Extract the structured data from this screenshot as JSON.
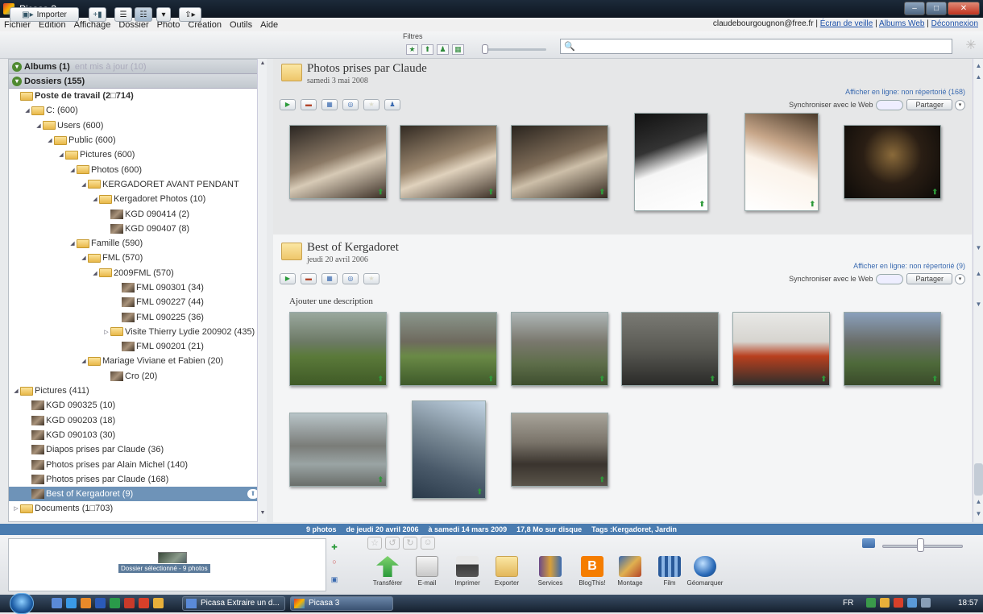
{
  "window": {
    "title": "Picasa 3"
  },
  "menu": [
    "Fichier",
    "Edition",
    "Affichage",
    "Dossier",
    "Photo",
    "Création",
    "Outils",
    "Aide"
  ],
  "account": {
    "email": "claudebourgougnon@free.fr",
    "sep": "|",
    "screensaver": "Écran de veille",
    "web_albums": "Albums Web",
    "logout": "Déconnexion"
  },
  "toolbar": {
    "import_label": "Importer",
    "filters_label": "Filtres",
    "search_placeholder": ""
  },
  "left_panel": {
    "albums_header": "Albums (1)",
    "albums_ghost": "ent mis à jour (10)",
    "folders_header": "Dossiers (155)",
    "tree": [
      {
        "label": "Poste de travail (2□714)",
        "depth": 0,
        "arrow": "",
        "icon": "folder",
        "bold": true
      },
      {
        "label": "C: (600)",
        "depth": 1,
        "arrow": "◢",
        "icon": "folder"
      },
      {
        "label": "Users (600)",
        "depth": 2,
        "arrow": "◢",
        "icon": "folder"
      },
      {
        "label": "Public (600)",
        "depth": 3,
        "arrow": "◢",
        "icon": "folder"
      },
      {
        "label": "Pictures (600)",
        "depth": 4,
        "arrow": "◢",
        "icon": "folder"
      },
      {
        "label": "Photos (600)",
        "depth": 5,
        "arrow": "◢",
        "icon": "folder"
      },
      {
        "label": "KERGADORET AVANT PENDANT",
        "depth": 6,
        "arrow": "◢",
        "icon": "folder"
      },
      {
        "label": "Kergadoret Photos (10)",
        "depth": 7,
        "arrow": "◢",
        "icon": "folder"
      },
      {
        "label": "KGD 090414 (2)",
        "depth": 8,
        "arrow": "",
        "icon": "thumb"
      },
      {
        "label": "KGD 090407 (8)",
        "depth": 8,
        "arrow": "",
        "icon": "thumb"
      },
      {
        "label": "Famille (590)",
        "depth": 5,
        "arrow": "◢",
        "icon": "folder"
      },
      {
        "label": "FML (570)",
        "depth": 6,
        "arrow": "◢",
        "icon": "folder"
      },
      {
        "label": "2009FML (570)",
        "depth": 7,
        "arrow": "◢",
        "icon": "folder"
      },
      {
        "label": "FML 090301 (34)",
        "depth": 9,
        "arrow": "",
        "icon": "thumb"
      },
      {
        "label": "FML 090227 (44)",
        "depth": 9,
        "arrow": "",
        "icon": "thumb"
      },
      {
        "label": "FML 090225 (36)",
        "depth": 9,
        "arrow": "",
        "icon": "thumb"
      },
      {
        "label": "Visite Thierry Lydie 200902 (435)",
        "depth": 8,
        "arrow": "▷",
        "icon": "folder"
      },
      {
        "label": "FML 090201 (21)",
        "depth": 9,
        "arrow": "",
        "icon": "thumb"
      },
      {
        "label": "Mariage Viviane et Fabien (20)",
        "depth": 6,
        "arrow": "◢",
        "icon": "folder"
      },
      {
        "label": "Cro (20)",
        "depth": 8,
        "arrow": "",
        "icon": "thumb"
      },
      {
        "label": "Pictures (411)",
        "depth": 0,
        "arrow": "◢",
        "icon": "folder"
      },
      {
        "label": "KGD 090325 (10)",
        "depth": 1,
        "arrow": "",
        "icon": "thumb"
      },
      {
        "label": "KGD 090203 (18)",
        "depth": 1,
        "arrow": "",
        "icon": "thumb"
      },
      {
        "label": "KGD 090103 (30)",
        "depth": 1,
        "arrow": "",
        "icon": "thumb"
      },
      {
        "label": "Diapos prises par Claude (36)",
        "depth": 1,
        "arrow": "",
        "icon": "thumb"
      },
      {
        "label": "Photos prises par Alain Michel (140)",
        "depth": 1,
        "arrow": "",
        "icon": "thumb"
      },
      {
        "label": "Photos prises par Claude (168)",
        "depth": 1,
        "arrow": "",
        "icon": "thumb"
      },
      {
        "label": "Best of Kergadoret (9)",
        "depth": 1,
        "arrow": "",
        "icon": "thumb",
        "selected": true
      },
      {
        "label": "Documents (1□703)",
        "depth": 0,
        "arrow": "▷",
        "icon": "folder"
      }
    ]
  },
  "sections": [
    {
      "title": "Photos prises par Claude",
      "date": "samedi 3 mai 2008",
      "online": "Afficher en ligne: non répertorié (168)",
      "sync": "Synchroniser avec le Web",
      "share": "Partager"
    },
    {
      "title": "Best of Kergadoret",
      "date": "jeudi 20 avril 2006",
      "online": "Afficher en ligne: non répertorié (9)",
      "sync": "Synchroniser avec le Web",
      "share": "Partager",
      "description": "Ajouter une description"
    }
  ],
  "statusbar": [
    "9 photos",
    "de jeudi 20 avril 2006",
    "à samedi 14 mars 2009",
    "17,8 Mo sur disque",
    "Tags :Kergadoret, Jardin"
  ],
  "tray": {
    "label": "Dossier sélectionné - 9 photos"
  },
  "actions": [
    "Transférer",
    "E-mail",
    "Imprimer",
    "Exporter",
    "Services",
    "BlogThis!",
    "Montage",
    "Film",
    "Géomarquer"
  ],
  "taskbar": {
    "task1": "Picasa Extraire un d...",
    "task2": "Picasa 3",
    "lang": "FR",
    "clock": "18:57"
  },
  "colors": {
    "selection": "#6e93b8",
    "statusbar": "#4a7cb0",
    "link": "#3a6ab0"
  }
}
